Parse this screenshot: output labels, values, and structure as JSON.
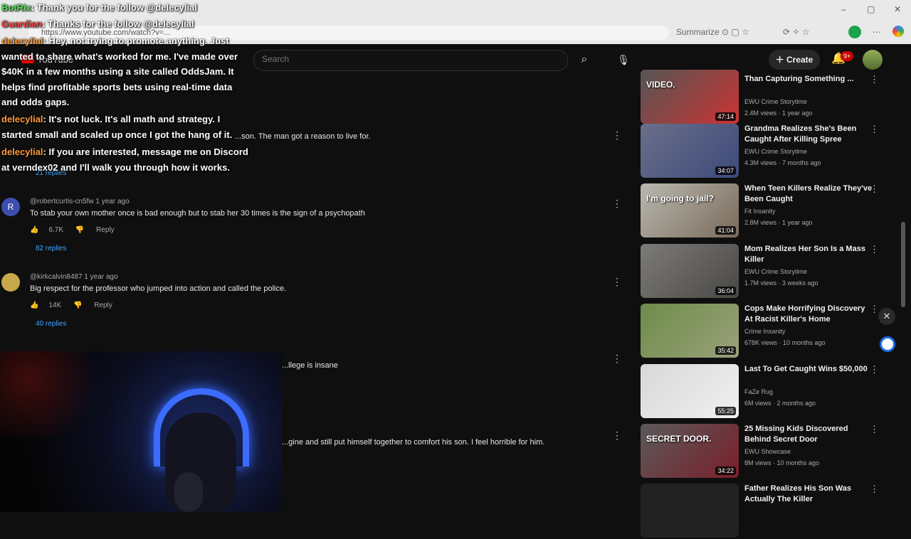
{
  "browser": {
    "url": "https://www.youtube.com/watch?v=...",
    "summarize_label": "Summarize"
  },
  "header": {
    "logo_text": "YouTube",
    "search_placeholder": "Search",
    "create_label": "Create",
    "notification_count": "9+"
  },
  "chat": [
    {
      "user": "BotRix",
      "sep": ": ",
      "text": "Thank you for the follow @delecylial",
      "style": "bot"
    },
    {
      "user": "Guardian",
      "sep": ": ",
      "text": "Thanks for the follow @delecylial",
      "style": "red"
    },
    {
      "user": "delecylial",
      "sep": ": ",
      "text": "Hey, not trying to promote anything. Just wanted to share what's worked for me. I've made over $40K in a few months using a site called OddsJam. It helps find profitable sports bets using real-time data and odds gaps.",
      "style": "orange"
    },
    {
      "user": "delecylial",
      "sep": ": ",
      "text": "It's not luck. It's all math and strategy. I started small and scaled up once I got the hang of it.",
      "style": "orange"
    },
    {
      "user": "delecylial",
      "sep": ": ",
      "text": "If you are interested, message me on Discord at verndex02 and I'll walk you through how it works.",
      "style": "orange"
    }
  ],
  "comments": [
    {
      "author": "",
      "text": "...son. The man got a reason to live for.",
      "likes": "",
      "reply": "",
      "replies": "21 replies"
    },
    {
      "author": "@robertcurtis-cn5fw",
      "time": "1 year ago",
      "text": "To stab your own mother once is bad enough but to stab her 30 times is the sign of a psychopath",
      "likes": "6.7K",
      "reply": "Reply",
      "replies": "82 replies"
    },
    {
      "author": "@kirkcalvin8487",
      "time": "1 year ago",
      "text": "Big respect for the professor who jumped into action and called the police.",
      "likes": "14K",
      "reply": "Reply",
      "replies": "40 replies"
    },
    {
      "author": "",
      "text": "...llege is insane",
      "likes": "",
      "reply": "",
      "replies": ""
    },
    {
      "author": "",
      "text": "...gine and still put himself together to comfort his son. I feel horrible for him.",
      "likes": "",
      "reply": "",
      "replies": ""
    }
  ],
  "sidebar": [
    {
      "title": "Than Capturing Something ...",
      "channel": "EWU Crime Storytime",
      "meta": "2.4M views · 1 year ago",
      "duration": "47:14",
      "caption": "VIDEO.",
      "colors": [
        "#555",
        "#c33"
      ]
    },
    {
      "title": "Grandma Realizes She's Been Caught After Killing Spree",
      "channel": "EWU Crime Storytime",
      "meta": "4.3M views · 7 months ago",
      "duration": "34:07",
      "caption": "",
      "colors": [
        "#6a6f8a",
        "#3d4a7a"
      ]
    },
    {
      "title": "When Teen Killers Realize They've Been Caught",
      "channel": "Fit Insanity",
      "meta": "2.8M views · 1 year ago",
      "duration": "41:04",
      "caption": "I'm going to jail?",
      "colors": [
        "#b9b8b0",
        "#7a6a5a"
      ]
    },
    {
      "title": "Mom Realizes Her Son Is a Mass Killer",
      "channel": "EWU Crime Storytime",
      "meta": "1.7M views · 3 weeks ago",
      "duration": "36:04",
      "caption": "",
      "colors": [
        "#7d7b78",
        "#4a4846"
      ]
    },
    {
      "title": "Cops Make Horrifying Discovery At Racist Killer's Home",
      "channel": "Crime Insanity",
      "meta": "678K views · 10 months ago",
      "duration": "35:42",
      "caption": "",
      "colors": [
        "#6d8c4a",
        "#9aa17a"
      ]
    },
    {
      "title": "Last To Get Caught Wins $50,000",
      "channel": "FaZe Rug",
      "meta": "6M views · 2 months ago",
      "duration": "55:25",
      "caption": "",
      "colors": [
        "#d8d8d8",
        "#f0f0f0"
      ]
    },
    {
      "title": "25 Missing Kids Discovered Behind Secret Door",
      "channel": "EWU Showcase",
      "meta": "8M views · 10 months ago",
      "duration": "34:22",
      "caption": "SECRET DOOR.",
      "colors": [
        "#5a5a5a",
        "#7a1f2a"
      ]
    },
    {
      "title": "Father Realizes His Son Was Actually The Killer",
      "channel": "",
      "meta": "",
      "duration": "",
      "caption": "",
      "colors": [
        "#222",
        "#222"
      ]
    }
  ]
}
